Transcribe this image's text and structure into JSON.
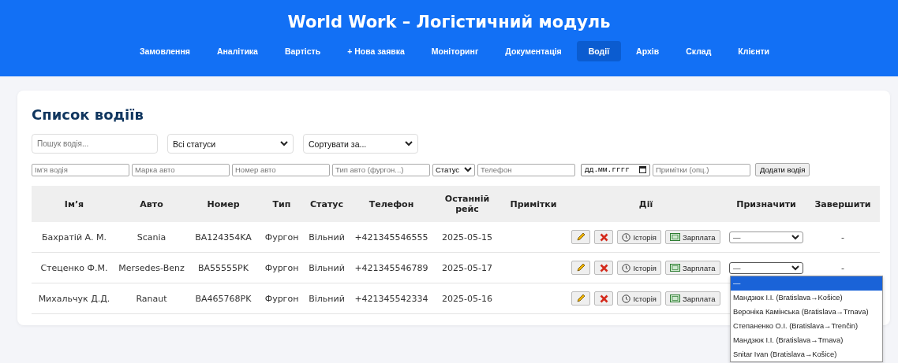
{
  "header": {
    "title": "World Work – Логістичний модуль",
    "nav": [
      {
        "label": "Замовлення",
        "selected": false
      },
      {
        "label": "Аналітика",
        "selected": false
      },
      {
        "label": "Вартість",
        "selected": false
      },
      {
        "label": "+ Нова заявка",
        "selected": false
      },
      {
        "label": "Моніторинг",
        "selected": false
      },
      {
        "label": "Документація",
        "selected": false
      },
      {
        "label": "Водії",
        "selected": true
      },
      {
        "label": "Архів",
        "selected": false
      },
      {
        "label": "Склад",
        "selected": false
      },
      {
        "label": "Клієнти",
        "selected": false
      }
    ]
  },
  "heading": "Список водіїв",
  "filters": {
    "search_placeholder": "Пошук водія...",
    "status": "Всі статуси",
    "sort": "Сортувати за..."
  },
  "add_form": {
    "name_placeholder": "Ім’я водія",
    "brand_placeholder": "Марка авто",
    "number_placeholder": "Номер авто",
    "type_placeholder": "Тип авто (фургон...)",
    "status": "Статус",
    "phone_placeholder": "Телефон",
    "date_placeholder": "дд.мм.гггг",
    "notes_placeholder": "Примітки (опц.)",
    "button": "Додати водія"
  },
  "table": {
    "columns": [
      "Ім’я",
      "Авто",
      "Номер",
      "Тип",
      "Статус",
      "Телефон",
      "Останній рейс",
      "Примітки",
      "Дії",
      "Призначити",
      "Завершити"
    ],
    "rows": [
      {
        "name": "Бахратій А. М.",
        "car": "Scania",
        "number": "BA124354KA",
        "type": "Фургон",
        "status": "Вільний",
        "phone": "+421345546555",
        "last_trip": "2025-05-15",
        "history": "Історія",
        "salary": "Зарплата",
        "assign": "—",
        "finish": "-",
        "dropdown_open": false
      },
      {
        "name": "Стеценко Ф.М.",
        "car": "Mersedes-Benz",
        "number": "BA55555PK",
        "type": "Фургон",
        "status": "Вільний",
        "phone": "+421345546789",
        "last_trip": "2025-05-17",
        "history": "Історія",
        "salary": "Зарплата",
        "assign": "—",
        "finish": "-",
        "dropdown_open": true
      },
      {
        "name": "Михальчук Д.Д.",
        "car": "Ranaut",
        "number": "BA465768PK",
        "type": "Фургон",
        "status": "Вільний",
        "phone": "+421345542334",
        "last_trip": "2025-05-16",
        "history": "Історія",
        "salary": "Зарплата"
      }
    ]
  },
  "assign_options": [
    {
      "label": "—",
      "selected": true
    },
    {
      "label": "Мандзюк І.І. (Bratislava→Košice)",
      "selected": false
    },
    {
      "label": "Вероніка Камінська (Bratislava→Trnava)",
      "selected": false
    },
    {
      "label": "Степаненко О.І. (Bratislava→Trenčin)",
      "selected": false
    },
    {
      "label": "Мандзюк І.І. (Bratislava→Trnava)",
      "selected": false
    },
    {
      "label": "Snitar Ivan (Bratislava→Košice)",
      "selected": false
    }
  ]
}
